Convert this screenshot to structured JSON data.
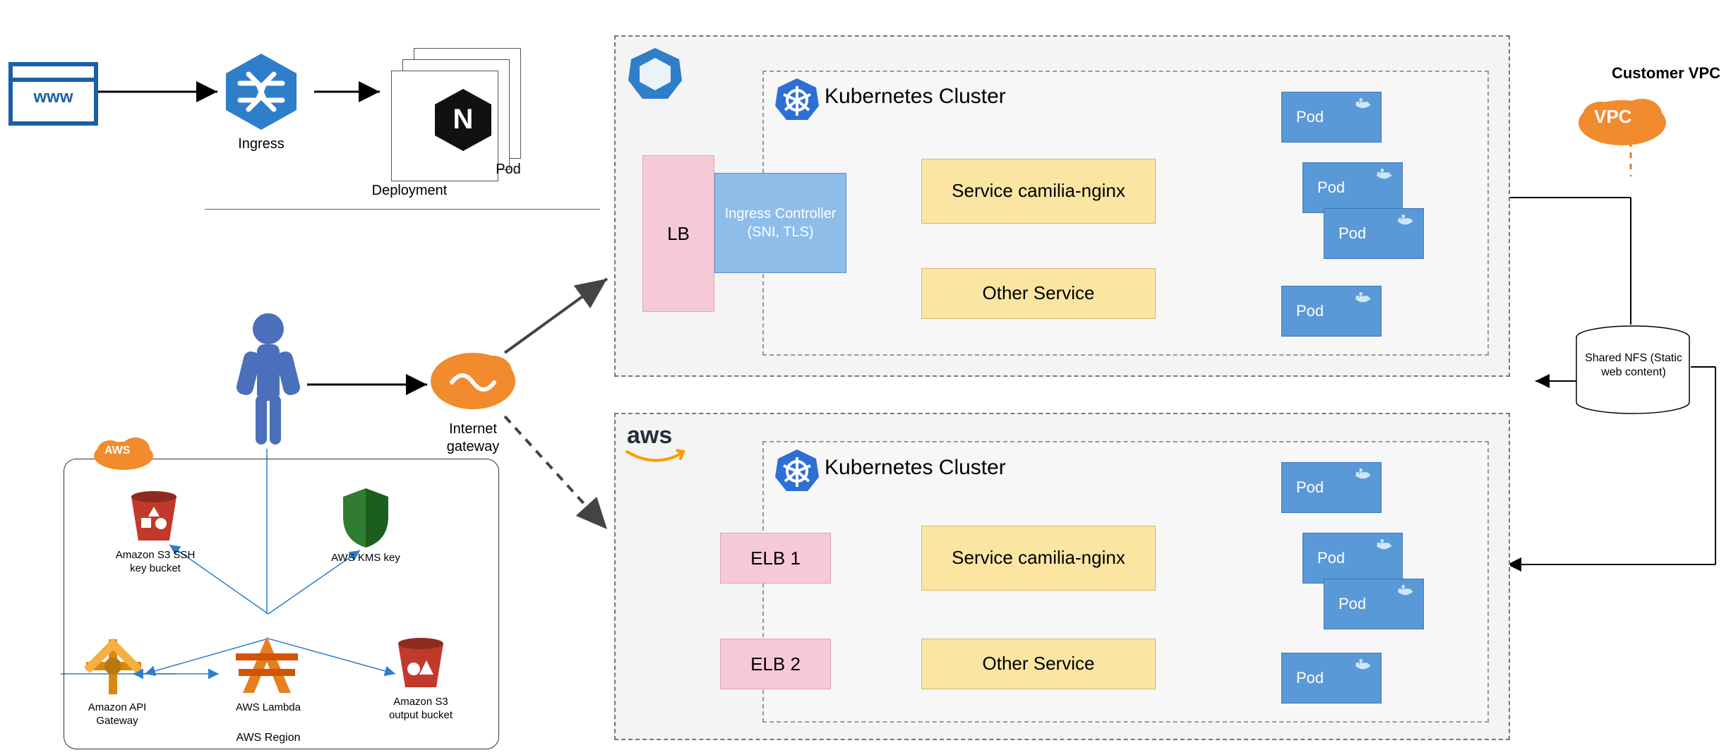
{
  "top": {
    "www": "www",
    "ingress": "Ingress",
    "deployment": "Deployment",
    "pod": "Pod"
  },
  "gateway": "Internet gateway",
  "cluster_label": "Kubernetes Cluster",
  "cluster1": {
    "lb": "LB",
    "ingress": "Ingress Controller (SNI, TLS)",
    "svc1": "Service camilia-nginx",
    "svc2": "Other Service",
    "pod": "Pod"
  },
  "cluster2": {
    "aws": "aws",
    "elb1": "ELB 1",
    "elb2": "ELB 2",
    "svc1": "Service camilia-nginx",
    "svc2": "Other Service",
    "pod": "Pod"
  },
  "vpc": {
    "label": "VPC",
    "customer": "Customer VPC"
  },
  "nfs": "Shared NFS (Static web content)",
  "aws_region": {
    "label": "AWS",
    "region": "AWS Region",
    "s3_ssh": "Amazon S3 SSH key bucket",
    "kms": "AWS KMS key",
    "api_gw": "Amazon API Gateway",
    "lambda": "AWS Lambda",
    "s3_out": "Amazon S3 output bucket"
  }
}
